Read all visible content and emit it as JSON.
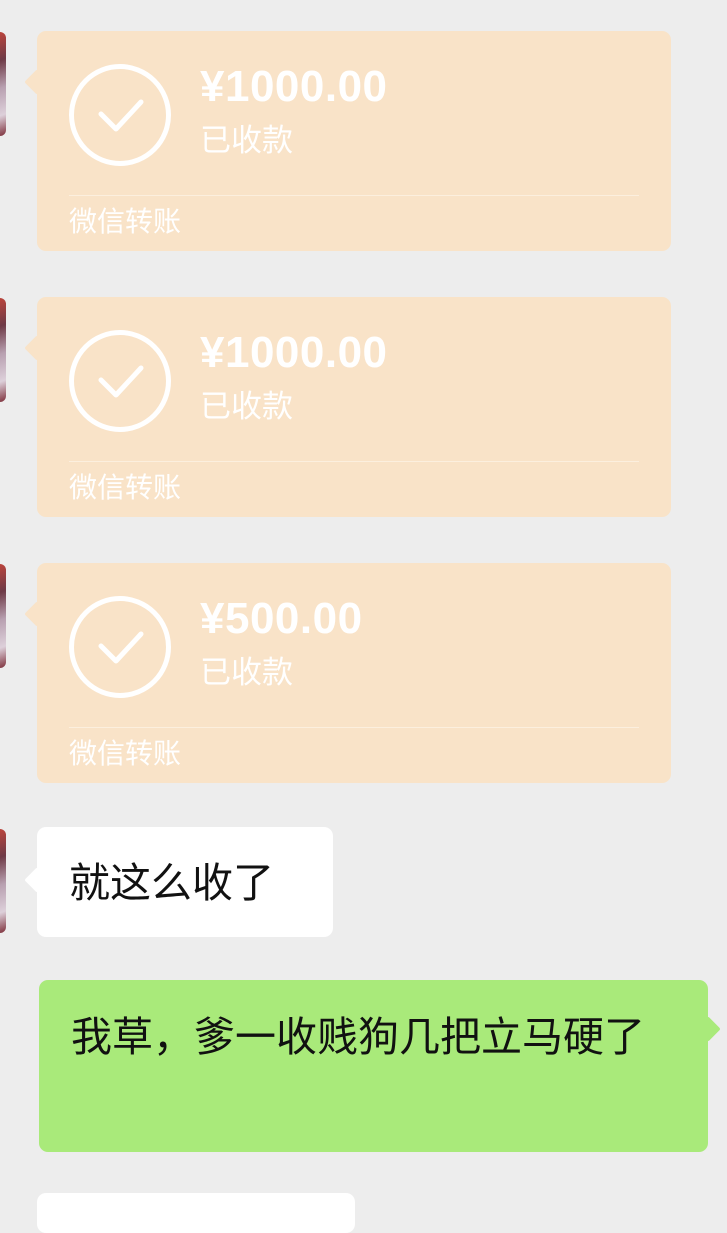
{
  "colors": {
    "background": "#ededed",
    "transfer_card": "#f9e3c8",
    "incoming_bubble": "#ffffff",
    "outgoing_bubble": "#a9ea7a"
  },
  "messages": [
    {
      "type": "transfer",
      "amount": "¥1000.00",
      "status": "已收款",
      "label": "微信转账",
      "icon": "check-circle-icon"
    },
    {
      "type": "transfer",
      "amount": "¥1000.00",
      "status": "已收款",
      "label": "微信转账",
      "icon": "check-circle-icon"
    },
    {
      "type": "transfer",
      "amount": "¥500.00",
      "status": "已收款",
      "label": "微信转账",
      "icon": "check-circle-icon"
    },
    {
      "type": "text",
      "direction": "incoming",
      "text": "就这么收了"
    },
    {
      "type": "text",
      "direction": "outgoing",
      "text": "我草，爹一收贱狗几把立马硬了"
    }
  ]
}
